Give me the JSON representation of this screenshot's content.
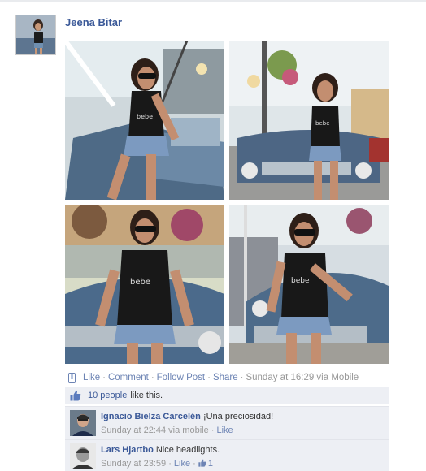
{
  "post": {
    "author": "Jeena Bitar",
    "photos": [
      {
        "alt": "photo-1"
      },
      {
        "alt": "photo-2"
      },
      {
        "alt": "photo-3"
      },
      {
        "alt": "photo-4"
      }
    ],
    "actions": {
      "like": "Like",
      "comment": "Comment",
      "follow": "Follow Post",
      "share": "Share",
      "timestamp": "Sunday at 16:29 via Mobile"
    },
    "likes": {
      "count_label": "10 people",
      "rest": "like this."
    },
    "comments": [
      {
        "name": "Ignacio Bielza Carcelén",
        "text": "¡Una preciosidad!",
        "time": "Sunday at 22:44 via mobile",
        "like": "Like"
      },
      {
        "name": "Lars Hjartbo",
        "text": "Nice headlights.",
        "time": "Sunday at 23:59",
        "like": "Like",
        "like_count": "1"
      }
    ]
  },
  "colors": {
    "link": "#3b5998",
    "link_light": "#6d84b4",
    "panel": "#edeff4"
  },
  "icons": [
    "mobile-icon",
    "thumbs-up-icon"
  ]
}
